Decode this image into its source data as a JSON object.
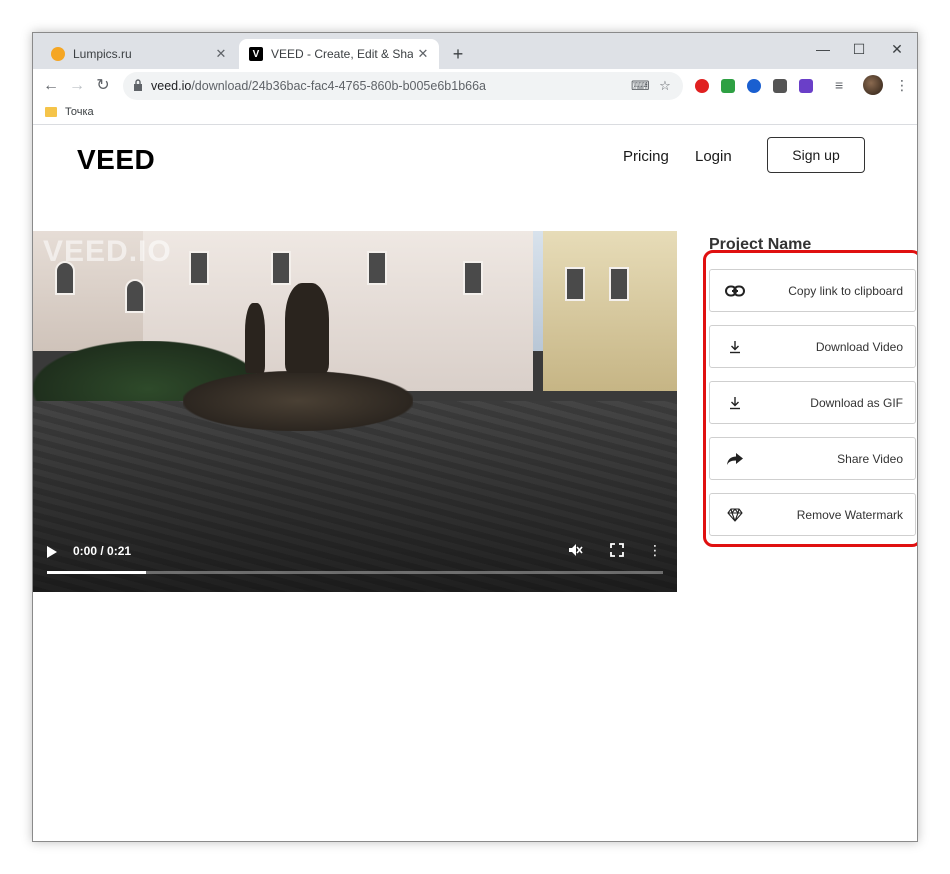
{
  "browser": {
    "tabs": [
      {
        "title": "Lumpics.ru",
        "active": false
      },
      {
        "title": "VEED - Create, Edit & Share Vide",
        "active": true
      }
    ],
    "new_tab": "+",
    "window_controls": {
      "minimize": "—",
      "maximize": "☐",
      "close": "✕"
    },
    "url": {
      "host": "veed.io",
      "path": "/download/24b36bac-fac4-4765-860b-b005e6b1b66a"
    },
    "bookmarks": [
      {
        "label": "Точка"
      }
    ]
  },
  "site": {
    "logo": "VEED",
    "nav": {
      "pricing": "Pricing",
      "login": "Login",
      "signup": "Sign up"
    }
  },
  "video": {
    "watermark": "VEED.IO",
    "time": "0:00 / 0:21",
    "progress_fraction": 0.16
  },
  "panel": {
    "project_name": "Project Name",
    "actions": [
      {
        "label": "Copy link to clipboard",
        "icon": "link-icon"
      },
      {
        "label": "Download Video",
        "icon": "download-icon"
      },
      {
        "label": "Download as GIF",
        "icon": "download-icon"
      },
      {
        "label": "Share Video",
        "icon": "share-arrow-icon"
      },
      {
        "label": "Remove Watermark",
        "icon": "diamond-icon"
      }
    ]
  },
  "colors": {
    "highlight": "#e01010",
    "tab_strip": "#dee1e6"
  }
}
